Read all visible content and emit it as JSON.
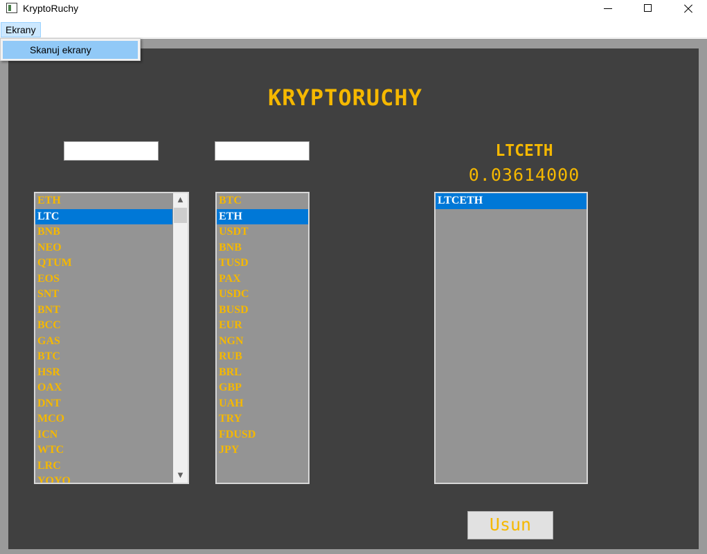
{
  "window": {
    "title": "KryptoRuchy"
  },
  "menu": {
    "ekrany": "Ekrany",
    "dropdown_items": [
      "Skanuj ekrany"
    ]
  },
  "app": {
    "title": "KRYPTORUCHY"
  },
  "inputs": {
    "base_value": "",
    "quote_value": ""
  },
  "selected_pair": {
    "name": "LTCETH",
    "price": "0.03614000"
  },
  "base_list": {
    "selected": "LTC",
    "items": [
      "ETH",
      "LTC",
      "BNB",
      "NEO",
      "QTUM",
      "EOS",
      "SNT",
      "BNT",
      "BCC",
      "GAS",
      "BTC",
      "HSR",
      "OAX",
      "DNT",
      "MCO",
      "ICN",
      "WTC",
      "LRC",
      "YOYO"
    ]
  },
  "quote_list": {
    "selected": "ETH",
    "items": [
      "BTC",
      "ETH",
      "USDT",
      "BNB",
      "TUSD",
      "PAX",
      "USDC",
      "BUSD",
      "EUR",
      "NGN",
      "RUB",
      "BRL",
      "GBP",
      "UAH",
      "TRY",
      "FDUSD",
      "JPY"
    ]
  },
  "pairs_list": {
    "selected": "LTCETH",
    "items": [
      "LTCETH"
    ]
  },
  "buttons": {
    "usun": "Usun"
  },
  "colors": {
    "accent": "#f5b800",
    "panel": "#404040",
    "list_bg": "#949494",
    "selection": "#0078d7",
    "frame": "#9a9a9a"
  },
  "icons": {
    "app": "app-window-icon",
    "minimize": "minimize-icon",
    "maximize": "maximize-icon",
    "close": "close-icon",
    "scroll_up": "chevron-up-icon",
    "scroll_down": "chevron-down-icon"
  }
}
